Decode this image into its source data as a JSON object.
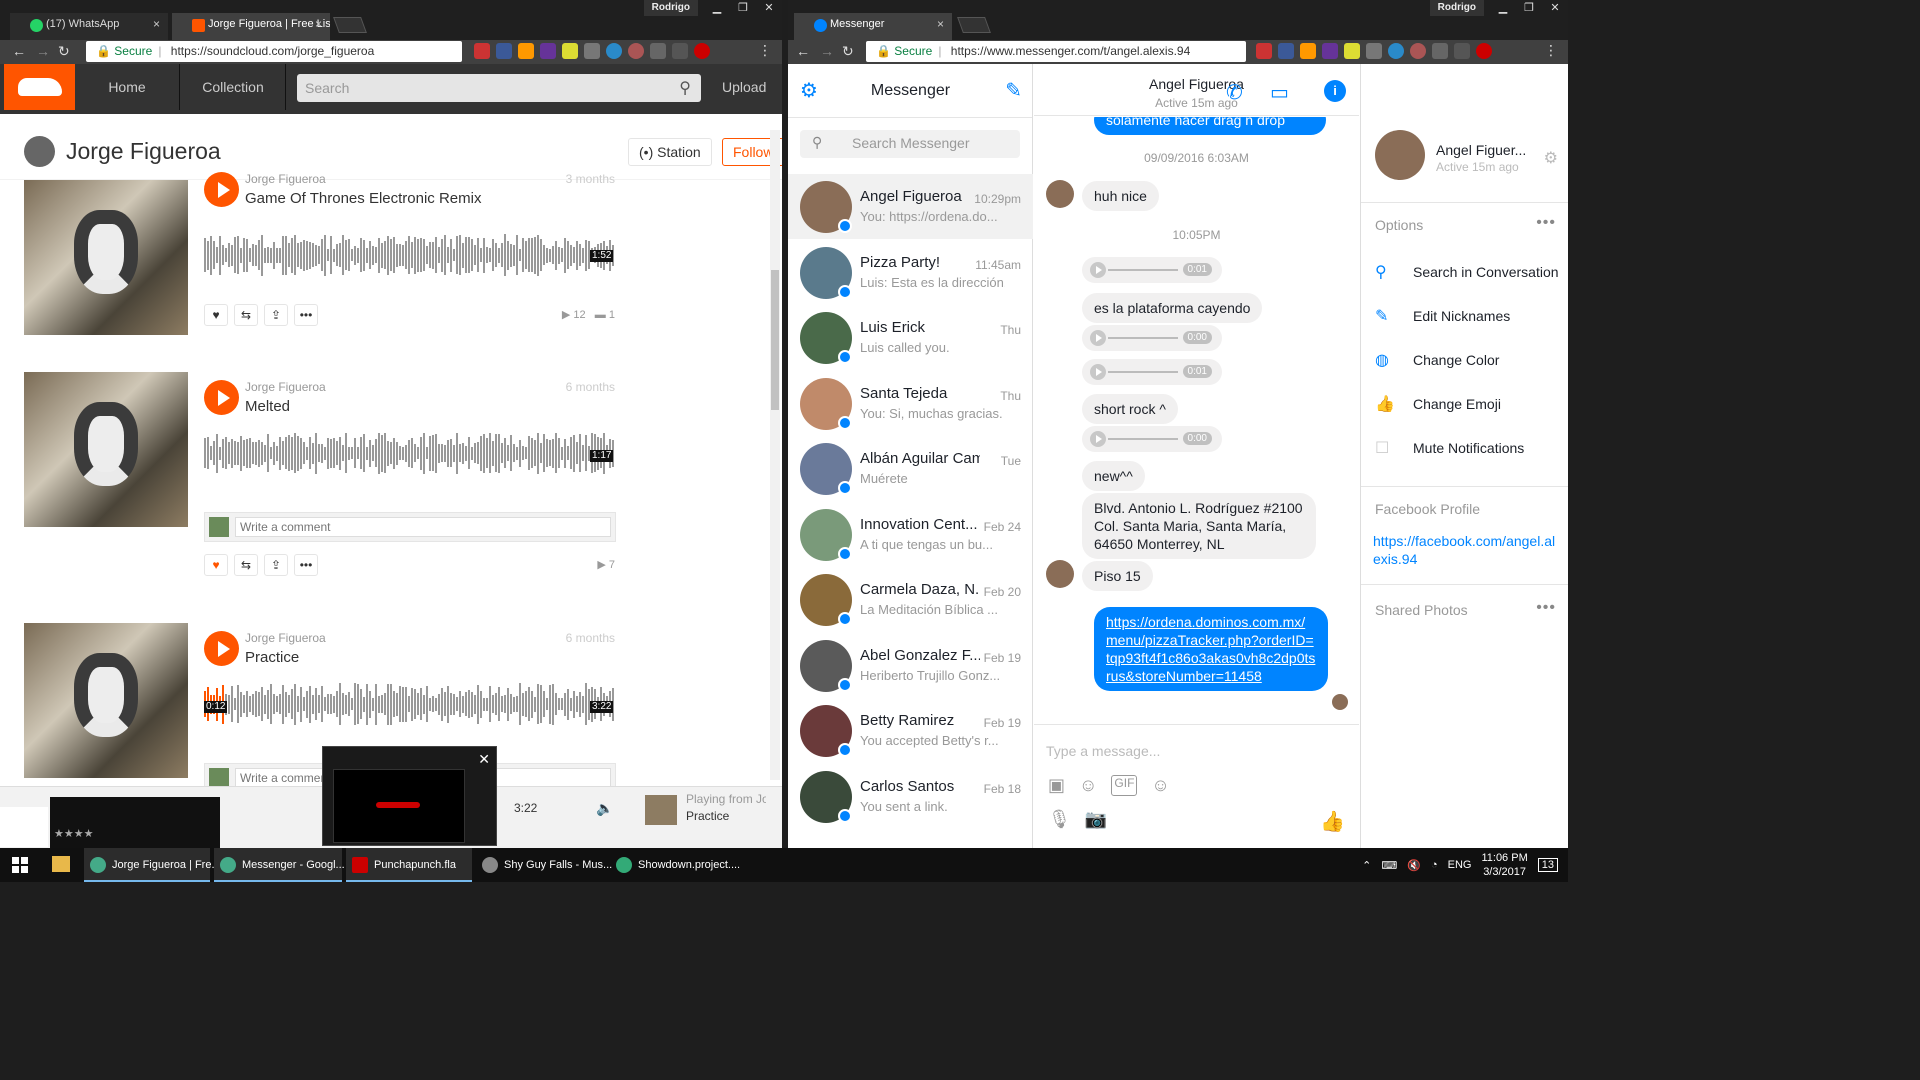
{
  "left_browser": {
    "tabs": [
      {
        "label": "(17) WhatsApp",
        "close": "×"
      },
      {
        "label": "Jorge Figueroa | Free List",
        "close": "×"
      }
    ],
    "user": "Rodrigo",
    "secure": "Secure",
    "url": "https://soundcloud.com/jorge_figueroa",
    "window_buttons": [
      "▁",
      "❐",
      "✕"
    ]
  },
  "soundcloud": {
    "nav": [
      "Home",
      "Collection"
    ],
    "search_placeholder": "Search",
    "upload": "Upload",
    "profile_name": "Jorge Figueroa",
    "station": "Station",
    "follow": "Follow",
    "tracks": [
      {
        "user": "Jorge Figueroa",
        "title": "Game Of Thrones Electronic Remix",
        "date": "3 months",
        "duration": "1:52",
        "plays": "12",
        "comments": "1",
        "progress": 0
      },
      {
        "user": "Jorge Figueroa",
        "title": "Melted",
        "date": "6 months",
        "duration": "1:17",
        "plays": "7",
        "progress": 0
      },
      {
        "user": "Jorge Figueroa",
        "title": "Practice",
        "date": "6 months",
        "duration": "3:22",
        "elapsed": "0:12",
        "progress": 0.05
      }
    ],
    "comment_placeholder": "Write a comment",
    "player": {
      "time": "3:22",
      "playing_from": "Playing from Jo",
      "track": "Practice"
    }
  },
  "right_browser": {
    "tabs": [
      {
        "label": "Messenger",
        "close": "×"
      }
    ],
    "user": "Rodrigo",
    "secure": "Secure",
    "url": "https://www.messenger.com/t/angel.alexis.94",
    "window_buttons": [
      "▁",
      "❐",
      "✕"
    ]
  },
  "messenger": {
    "title": "Messenger",
    "search_placeholder": "Search Messenger",
    "conversations": [
      {
        "name": "Angel Figueroa",
        "time": "10:29pm",
        "preview": "You: https://ordena.do...",
        "color": "#8a6d57"
      },
      {
        "name": "Pizza Party!",
        "time": "11:45am",
        "preview": "Luis: Esta es la dirección...",
        "color": "#5a7a8c"
      },
      {
        "name": "Luis Erick",
        "time": "Thu",
        "preview": "Luis called you.",
        "color": "#4a6a4a"
      },
      {
        "name": "Santa Tejeda",
        "time": "Thu",
        "preview": "You: Si, muchas gracias.",
        "color": "#c08a6a"
      },
      {
        "name": "Albán Aguilar Cam...",
        "time": "Tue",
        "preview": "Muérete",
        "color": "#6a7a9a"
      },
      {
        "name": "Innovation Cent...",
        "time": "Feb 24",
        "preview": "A ti que tengas un bu...",
        "color": "#7a9a7a"
      },
      {
        "name": "Carmela Daza, N...",
        "time": "Feb 20",
        "preview": "La Meditación Bíblica ...",
        "color": "#8a6a3a"
      },
      {
        "name": "Abel Gonzalez F...",
        "time": "Feb 19",
        "preview": "Heriberto Trujillo Gonz...",
        "color": "#5a5a5a"
      },
      {
        "name": "Betty Ramirez",
        "time": "Feb 19",
        "preview": "You accepted Betty's r...",
        "color": "#6a3a3a"
      },
      {
        "name": "Carlos Santos",
        "time": "Feb 18",
        "preview": "You sent a link.",
        "color": "#3a4a3a"
      }
    ],
    "chat": {
      "name": "Angel Figueroa",
      "active": "Active 15m ago",
      "messages": {
        "top_partial": "solamente hacer drag n drop",
        "date1": "09/09/2016 6:03AM",
        "m1": "huh nice",
        "date2": "10:05PM",
        "a1": "0:01",
        "m2": "es la plataforma cayendo",
        "a2": "0:00",
        "a3": "0:01",
        "m3": "short rock ^",
        "a4": "0:00",
        "m4": "new^^",
        "m5": "Blvd. Antonio L. Rodríguez #2100 Col. Santa Maria, Santa María, 64650 Monterrey, NL",
        "m6": "Piso 15",
        "m7": "https://ordena.dominos.com.mx/menu/pizzaTracker.php?orderID=tqp93ft4f1c86o3akas0vh8c2dp0tsrus&storeNumber=11458"
      },
      "type_placeholder": "Type a message..."
    },
    "details": {
      "name": "Angel Figuer...",
      "active": "Active 15m ago",
      "options_label": "Options",
      "options": [
        "Search in Conversation",
        "Edit Nicknames",
        "Change Color",
        "Change Emoji",
        "Mute Notifications"
      ],
      "fb_label": "Facebook Profile",
      "fb_link": "https://facebook.com/angel.alexis.94",
      "shared_photos": "Shared Photos"
    }
  },
  "taskbar": {
    "items": [
      {
        "label": "Jorge Figueroa | Fre..."
      },
      {
        "label": "Messenger - Googl..."
      },
      {
        "label": "Punchapunch.fla"
      },
      {
        "label": "Shy Guy Falls - Mus..."
      },
      {
        "label": "Showdown.project...."
      }
    ],
    "lang": "ENG",
    "time": "11:06 PM",
    "date": "3/3/2017",
    "notifications": "13"
  }
}
